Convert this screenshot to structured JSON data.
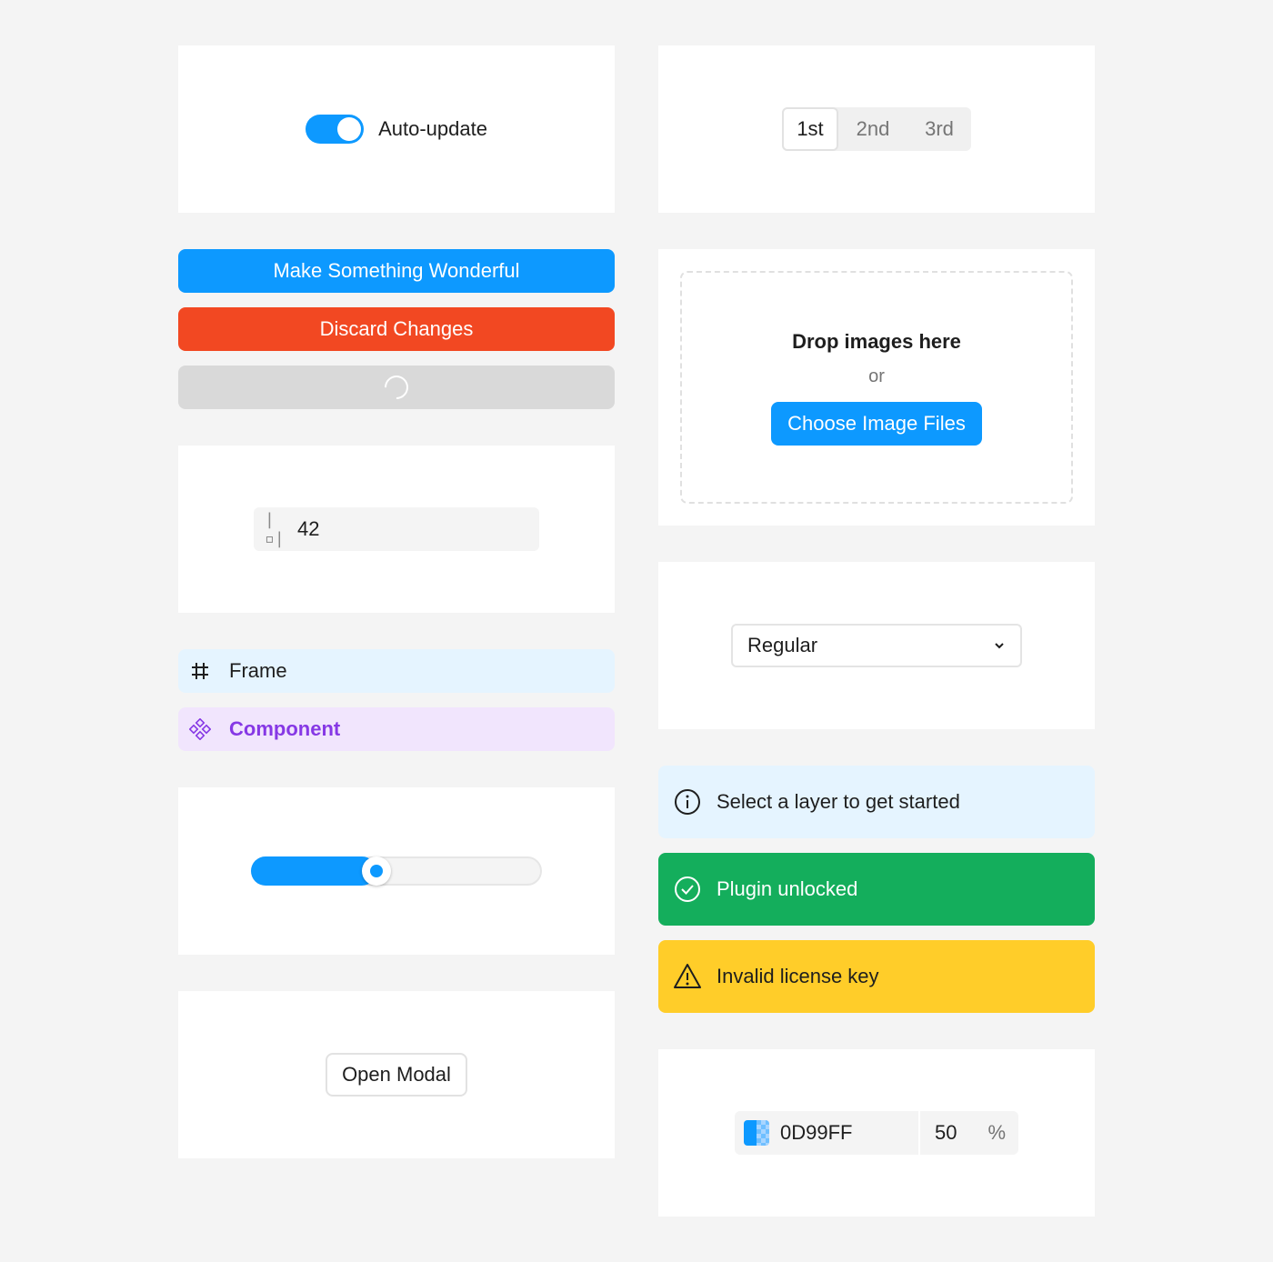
{
  "toggle": {
    "label": "Auto-update",
    "checked": true,
    "color": "#0d99ff"
  },
  "segmented": {
    "options": [
      "1st",
      "2nd",
      "3rd"
    ],
    "selected": "1st"
  },
  "buttons": {
    "primary_label": "Make Something Wonderful",
    "danger_label": "Discard Changes",
    "loading_state": "loading",
    "primary_color": "#0d99ff",
    "danger_color": "#f24822",
    "disabled_color": "#d9d9d9"
  },
  "dropzone": {
    "title": "Drop images here",
    "or_text": "or",
    "button_label": "Choose Image Files"
  },
  "number_input": {
    "icon": "spacing-icon",
    "icon_glyph": "|▫|",
    "value": "42"
  },
  "dropdown": {
    "value": "Regular",
    "icon": "chevron-down-icon"
  },
  "layers": {
    "frame": {
      "label": "Frame",
      "icon": "frame-icon",
      "bg": "#e5f4ff",
      "color": "#1e1e1e"
    },
    "component": {
      "label": "Component",
      "icon": "component-icon",
      "bg": "#f1e5fd",
      "color": "#8638e5"
    }
  },
  "banners": {
    "info": {
      "text": "Select a layer to get started",
      "icon": "info-icon",
      "bg": "#e5f4ff"
    },
    "success": {
      "text": "Plugin unlocked",
      "icon": "check-circle-icon",
      "bg": "#14ae5c"
    },
    "warning": {
      "text": "Invalid license key",
      "icon": "warning-icon",
      "bg": "#ffcd29"
    }
  },
  "slider": {
    "value_fraction": 0.43
  },
  "modal": {
    "button_label": "Open Modal"
  },
  "color_input": {
    "hex": "0D99FF",
    "opacity": "50",
    "opacity_unit": "%",
    "swatch_color": "#0d99ff"
  }
}
